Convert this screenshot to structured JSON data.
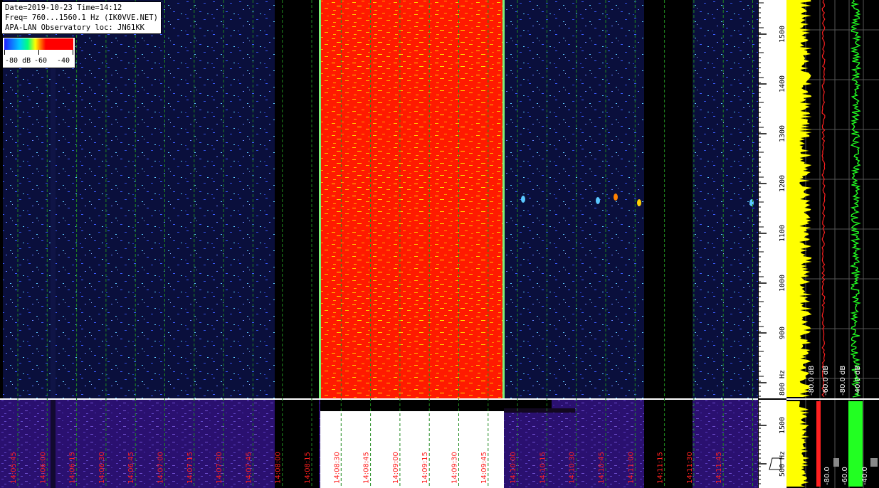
{
  "info": {
    "line1": "Date=2019-10-23 Time=14:12",
    "line2": "Freq= 760...1560.1 Hz (IK0VVE.NET)",
    "line3": "APA-LAN Observatory loc: JN61KK"
  },
  "colorbar": {
    "low": "-80 dB",
    "mid": "-60",
    "high": "-40"
  },
  "freq_axis": {
    "ticks": [
      "1500",
      "1400",
      "1300",
      "1200",
      "1100",
      "1000",
      "900",
      "800 Hz"
    ],
    "lower_ticks": [
      "1500",
      "500 Hz"
    ]
  },
  "time_labels": [
    "14:05:45",
    "14:06:00",
    "14:06:15",
    "14:06:30",
    "14:06:45",
    "14:07:00",
    "14:07:15",
    "14:07:30",
    "14:07:45",
    "14:08:00",
    "14:08:15",
    "14:08:30",
    "14:08:45",
    "14:09:00",
    "14:09:15",
    "14:09:30",
    "14:09:45",
    "14:10:00",
    "14:10:15",
    "14:10:30",
    "14:10:45",
    "14:11:00",
    "14:11:15",
    "14:11:30",
    "14:11:45"
  ],
  "trace_labels": [
    "-80.0 dB",
    "-60.0 dB",
    "-80.0 dB",
    "-40.0 dB"
  ],
  "trace_labels_lower": [
    "-80.0",
    "-60.0",
    "-40.0"
  ],
  "colors": {
    "background": "#0a0f3c",
    "signal": "#ff1a00",
    "grid": "#1f8a1f",
    "time_label": "#ff2020",
    "trace_yellow": "#ffff00",
    "trace_red": "#ff2020",
    "trace_green": "#22ff22"
  }
}
